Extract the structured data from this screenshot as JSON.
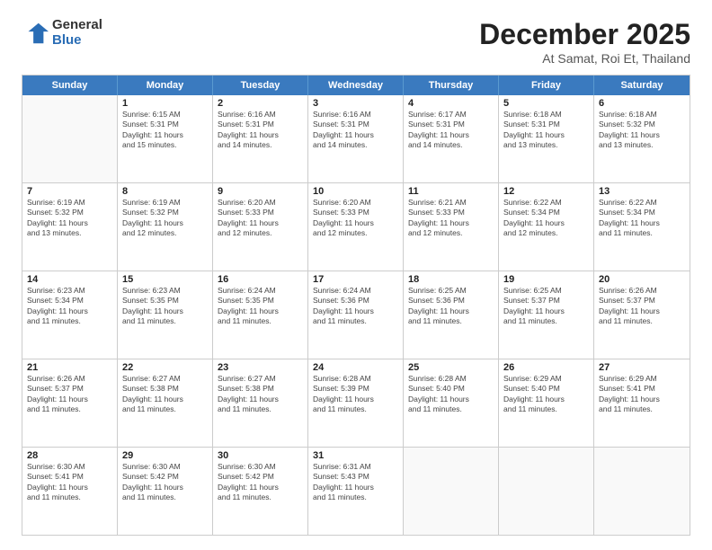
{
  "header": {
    "logo_general": "General",
    "logo_blue": "Blue",
    "main_title": "December 2025",
    "sub_title": "At Samat, Roi Et, Thailand"
  },
  "weekdays": [
    "Sunday",
    "Monday",
    "Tuesday",
    "Wednesday",
    "Thursday",
    "Friday",
    "Saturday"
  ],
  "rows": [
    [
      {
        "day": "",
        "lines": []
      },
      {
        "day": "1",
        "lines": [
          "Sunrise: 6:15 AM",
          "Sunset: 5:31 PM",
          "Daylight: 11 hours",
          "and 15 minutes."
        ]
      },
      {
        "day": "2",
        "lines": [
          "Sunrise: 6:16 AM",
          "Sunset: 5:31 PM",
          "Daylight: 11 hours",
          "and 14 minutes."
        ]
      },
      {
        "day": "3",
        "lines": [
          "Sunrise: 6:16 AM",
          "Sunset: 5:31 PM",
          "Daylight: 11 hours",
          "and 14 minutes."
        ]
      },
      {
        "day": "4",
        "lines": [
          "Sunrise: 6:17 AM",
          "Sunset: 5:31 PM",
          "Daylight: 11 hours",
          "and 14 minutes."
        ]
      },
      {
        "day": "5",
        "lines": [
          "Sunrise: 6:18 AM",
          "Sunset: 5:31 PM",
          "Daylight: 11 hours",
          "and 13 minutes."
        ]
      },
      {
        "day": "6",
        "lines": [
          "Sunrise: 6:18 AM",
          "Sunset: 5:32 PM",
          "Daylight: 11 hours",
          "and 13 minutes."
        ]
      }
    ],
    [
      {
        "day": "7",
        "lines": [
          "Sunrise: 6:19 AM",
          "Sunset: 5:32 PM",
          "Daylight: 11 hours",
          "and 13 minutes."
        ]
      },
      {
        "day": "8",
        "lines": [
          "Sunrise: 6:19 AM",
          "Sunset: 5:32 PM",
          "Daylight: 11 hours",
          "and 12 minutes."
        ]
      },
      {
        "day": "9",
        "lines": [
          "Sunrise: 6:20 AM",
          "Sunset: 5:33 PM",
          "Daylight: 11 hours",
          "and 12 minutes."
        ]
      },
      {
        "day": "10",
        "lines": [
          "Sunrise: 6:20 AM",
          "Sunset: 5:33 PM",
          "Daylight: 11 hours",
          "and 12 minutes."
        ]
      },
      {
        "day": "11",
        "lines": [
          "Sunrise: 6:21 AM",
          "Sunset: 5:33 PM",
          "Daylight: 11 hours",
          "and 12 minutes."
        ]
      },
      {
        "day": "12",
        "lines": [
          "Sunrise: 6:22 AM",
          "Sunset: 5:34 PM",
          "Daylight: 11 hours",
          "and 12 minutes."
        ]
      },
      {
        "day": "13",
        "lines": [
          "Sunrise: 6:22 AM",
          "Sunset: 5:34 PM",
          "Daylight: 11 hours",
          "and 11 minutes."
        ]
      }
    ],
    [
      {
        "day": "14",
        "lines": [
          "Sunrise: 6:23 AM",
          "Sunset: 5:34 PM",
          "Daylight: 11 hours",
          "and 11 minutes."
        ]
      },
      {
        "day": "15",
        "lines": [
          "Sunrise: 6:23 AM",
          "Sunset: 5:35 PM",
          "Daylight: 11 hours",
          "and 11 minutes."
        ]
      },
      {
        "day": "16",
        "lines": [
          "Sunrise: 6:24 AM",
          "Sunset: 5:35 PM",
          "Daylight: 11 hours",
          "and 11 minutes."
        ]
      },
      {
        "day": "17",
        "lines": [
          "Sunrise: 6:24 AM",
          "Sunset: 5:36 PM",
          "Daylight: 11 hours",
          "and 11 minutes."
        ]
      },
      {
        "day": "18",
        "lines": [
          "Sunrise: 6:25 AM",
          "Sunset: 5:36 PM",
          "Daylight: 11 hours",
          "and 11 minutes."
        ]
      },
      {
        "day": "19",
        "lines": [
          "Sunrise: 6:25 AM",
          "Sunset: 5:37 PM",
          "Daylight: 11 hours",
          "and 11 minutes."
        ]
      },
      {
        "day": "20",
        "lines": [
          "Sunrise: 6:26 AM",
          "Sunset: 5:37 PM",
          "Daylight: 11 hours",
          "and 11 minutes."
        ]
      }
    ],
    [
      {
        "day": "21",
        "lines": [
          "Sunrise: 6:26 AM",
          "Sunset: 5:37 PM",
          "Daylight: 11 hours",
          "and 11 minutes."
        ]
      },
      {
        "day": "22",
        "lines": [
          "Sunrise: 6:27 AM",
          "Sunset: 5:38 PM",
          "Daylight: 11 hours",
          "and 11 minutes."
        ]
      },
      {
        "day": "23",
        "lines": [
          "Sunrise: 6:27 AM",
          "Sunset: 5:38 PM",
          "Daylight: 11 hours",
          "and 11 minutes."
        ]
      },
      {
        "day": "24",
        "lines": [
          "Sunrise: 6:28 AM",
          "Sunset: 5:39 PM",
          "Daylight: 11 hours",
          "and 11 minutes."
        ]
      },
      {
        "day": "25",
        "lines": [
          "Sunrise: 6:28 AM",
          "Sunset: 5:40 PM",
          "Daylight: 11 hours",
          "and 11 minutes."
        ]
      },
      {
        "day": "26",
        "lines": [
          "Sunrise: 6:29 AM",
          "Sunset: 5:40 PM",
          "Daylight: 11 hours",
          "and 11 minutes."
        ]
      },
      {
        "day": "27",
        "lines": [
          "Sunrise: 6:29 AM",
          "Sunset: 5:41 PM",
          "Daylight: 11 hours",
          "and 11 minutes."
        ]
      }
    ],
    [
      {
        "day": "28",
        "lines": [
          "Sunrise: 6:30 AM",
          "Sunset: 5:41 PM",
          "Daylight: 11 hours",
          "and 11 minutes."
        ]
      },
      {
        "day": "29",
        "lines": [
          "Sunrise: 6:30 AM",
          "Sunset: 5:42 PM",
          "Daylight: 11 hours",
          "and 11 minutes."
        ]
      },
      {
        "day": "30",
        "lines": [
          "Sunrise: 6:30 AM",
          "Sunset: 5:42 PM",
          "Daylight: 11 hours",
          "and 11 minutes."
        ]
      },
      {
        "day": "31",
        "lines": [
          "Sunrise: 6:31 AM",
          "Sunset: 5:43 PM",
          "Daylight: 11 hours",
          "and 11 minutes."
        ]
      },
      {
        "day": "",
        "lines": []
      },
      {
        "day": "",
        "lines": []
      },
      {
        "day": "",
        "lines": []
      }
    ]
  ]
}
